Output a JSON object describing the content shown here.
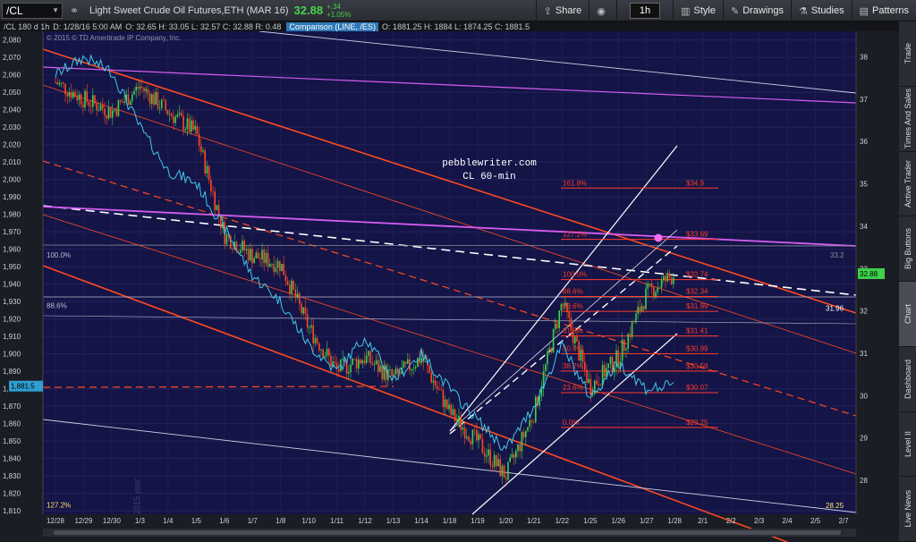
{
  "toolbar": {
    "symbol": "/CL",
    "description": "Light Sweet Crude Oil Futures,ETH (MAR 16)",
    "last": "32.88",
    "change": "+.34",
    "change_pct": "+1.05%",
    "timeframe": "1h",
    "buttons": [
      {
        "name": "share",
        "icon": "share-icon",
        "label": "Share"
      },
      {
        "name": "camera",
        "icon": "camera-icon",
        "label": ""
      },
      {
        "name": "timeframe",
        "icon": "",
        "label": "1h"
      },
      {
        "name": "style",
        "icon": "style-icon",
        "label": "Style"
      },
      {
        "name": "drawings",
        "icon": "pencil-icon",
        "label": "Drawings"
      },
      {
        "name": "studies",
        "icon": "flask-icon",
        "label": "Studies"
      },
      {
        "name": "patterns",
        "icon": "bars-icon",
        "label": "Patterns"
      }
    ]
  },
  "subbar": {
    "series": "/CL 180 d 1h",
    "date": "D: 1/28/16 5:00 AM",
    "ohlc": "O: 32.65   H: 33.05   L: 32.57   C: 32.88   R: 0.48",
    "comparison_label": "Comparison (LINE, /ES)",
    "cmp_ohlc": "O: 1881.25   H: 1884   L: 1874.25   C: 1881.5"
  },
  "sidebar": [
    "Trade",
    "Times And Sales",
    "Active Trader",
    "Big Buttons",
    "Chart",
    "Dashboard",
    "Level II",
    "Live News"
  ],
  "sidebar_active": "Chart",
  "copyright": "© 2015 © TD Ameritrade IP Company, Inc.",
  "watermark": "2015 year",
  "annotation": {
    "line1": "pebblewriter.com",
    "line2": "CL 60-min"
  },
  "colors": {
    "bg": "#141447",
    "candle_up": "#3ed14a",
    "candle_down": "#ff4a20",
    "comparison": "#41c9e8",
    "channel": "#ff4a20",
    "fib": "#ff3a28",
    "white": "#ffffff",
    "magenta": "#d65cf0"
  },
  "chart_data": {
    "type": "line",
    "left_axis": {
      "label": "/ES",
      "ylim": [
        1808,
        2085
      ],
      "ticks": [
        1810,
        1820,
        1830,
        1840,
        1850,
        1860,
        1870,
        1880,
        1890,
        1900,
        1910,
        1920,
        1930,
        1940,
        1950,
        1960,
        1970,
        1980,
        1990,
        2000,
        2010,
        2020,
        2030,
        2040,
        2050,
        2060,
        2070,
        2080
      ],
      "current": "1,881.5"
    },
    "right_axis": {
      "label": "/CL",
      "ylim": [
        27.2,
        38.6
      ],
      "ticks": [
        28,
        29,
        30,
        31,
        32,
        33,
        34,
        35,
        36,
        37,
        38
      ],
      "current": "32.88",
      "marker": "33.2"
    },
    "x_ticks": [
      "12/28",
      "12/29",
      "12/30",
      "1/3",
      "1/4",
      "1/5",
      "1/6",
      "1/7",
      "1/8",
      "1/10",
      "1/11",
      "1/12",
      "1/13",
      "1/14",
      "1/18",
      "1/19",
      "1/20",
      "1/21",
      "1/22",
      "1/25",
      "1/26",
      "1/27",
      "1/28",
      "2/1",
      "2/2",
      "2/3",
      "2/4",
      "2/5",
      "2/7"
    ],
    "close_path": [
      [
        "12/28",
        37.4
      ],
      [
        "12/29",
        37.0
      ],
      [
        "12/30",
        36.7
      ],
      [
        "1/3",
        37.3
      ],
      [
        "1/4",
        36.7
      ],
      [
        "1/5",
        36.2
      ],
      [
        "1/6",
        33.8
      ],
      [
        "1/7",
        33.3
      ],
      [
        "1/8",
        33.1
      ],
      [
        "1/10",
        31.6
      ],
      [
        "1/11",
        30.6
      ],
      [
        "1/12",
        30.9
      ],
      [
        "1/13",
        30.4
      ],
      [
        "1/14",
        30.9
      ],
      [
        "1/18",
        29.6
      ],
      [
        "1/19",
        28.9
      ],
      [
        "1/20",
        28.1
      ],
      [
        "1/21",
        29.6
      ],
      [
        "1/22",
        32.2
      ],
      [
        "1/25",
        30.2
      ],
      [
        "1/26",
        30.9
      ],
      [
        "1/27",
        32.4
      ],
      [
        "1/28",
        32.88
      ]
    ],
    "comparison_path": [
      [
        "12/28",
        2060
      ],
      [
        "12/29",
        2070
      ],
      [
        "12/30",
        2062
      ],
      [
        "1/3",
        2030
      ],
      [
        "1/4",
        2005
      ],
      [
        "1/5",
        1998
      ],
      [
        "1/6",
        1972
      ],
      [
        "1/7",
        1945
      ],
      [
        "1/8",
        1930
      ],
      [
        "1/10",
        1905
      ],
      [
        "1/11",
        1890
      ],
      [
        "1/12",
        1910
      ],
      [
        "1/13",
        1885
      ],
      [
        "1/14",
        1900
      ],
      [
        "1/18",
        1880
      ],
      [
        "1/19",
        1862
      ],
      [
        "1/20",
        1845
      ],
      [
        "1/21",
        1870
      ],
      [
        "1/22",
        1905
      ],
      [
        "1/25",
        1875
      ],
      [
        "1/26",
        1895
      ],
      [
        "1/27",
        1880
      ],
      [
        "1/28",
        1881.5
      ]
    ],
    "fib_levels": [
      {
        "label": "0.0%",
        "value": "$29.25",
        "y": 29.25
      },
      {
        "label": "23.6%",
        "value": "$30.07",
        "y": 30.07
      },
      {
        "label": "38.2%",
        "value": "$30.58",
        "y": 30.58
      },
      {
        "label": "50.0%",
        "value": "$30.99",
        "y": 30.99
      },
      {
        "label": "61.8%",
        "value": "$31.41",
        "y": 31.41
      },
      {
        "label": "78.6%",
        "value": "$31.99",
        "y": 31.99
      },
      {
        "label": "88.6%",
        "value": "$32.34",
        "y": 32.34
      },
      {
        "label": "100.0%",
        "value": "$32.74",
        "y": 32.74
      },
      {
        "label": "127.2%",
        "value": "$33.69",
        "y": 33.69
      },
      {
        "label": "161.8%",
        "value": "$34.9",
        "y": 34.9
      }
    ],
    "left_labels": [
      {
        "text": "100.0%",
        "y": 33.2
      },
      {
        "text": "88.6%",
        "y": 32.0
      },
      {
        "text": "127.2%",
        "y": 27.3
      }
    ],
    "right_labels": [
      {
        "text": "31.96",
        "y": 32.0
      },
      {
        "text": "28.25",
        "y": 27.35
      }
    ]
  }
}
